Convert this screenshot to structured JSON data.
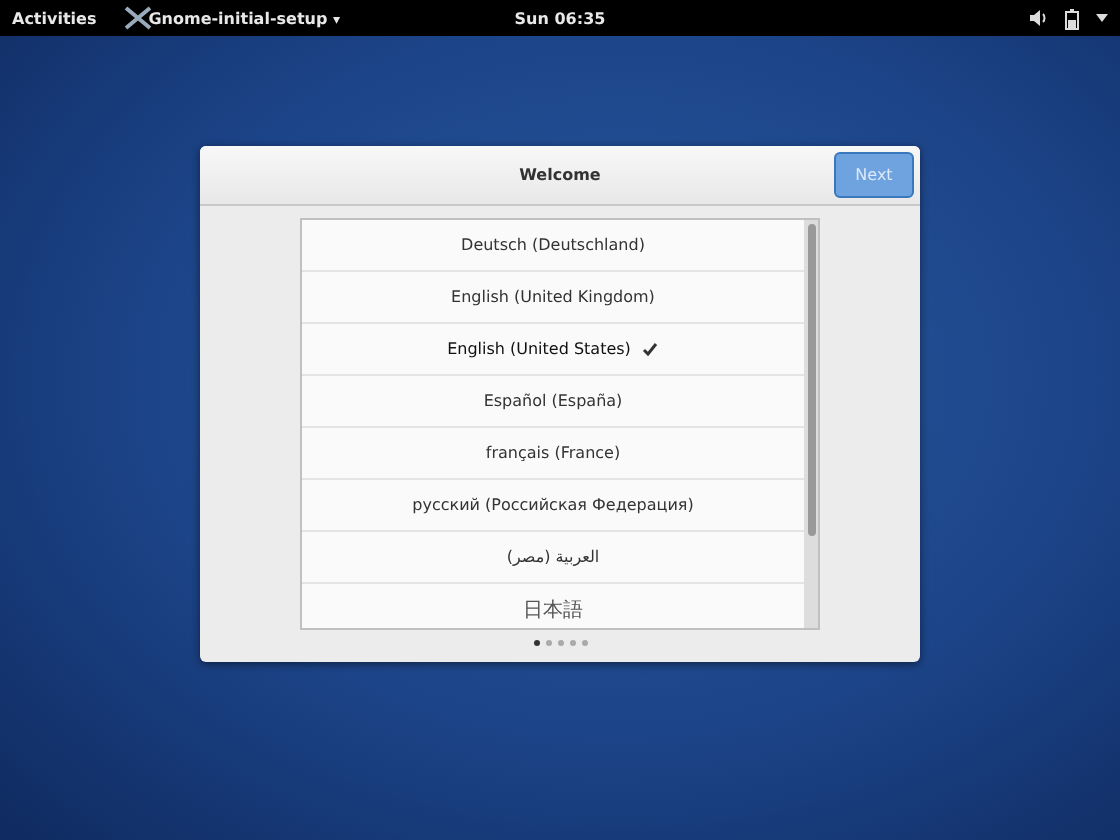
{
  "top_bar": {
    "activities": "Activities",
    "app_menu": "Gnome-initial-setup",
    "app_menu_caret": "▾",
    "clock": "Sun 06:35"
  },
  "dialog": {
    "title": "Welcome",
    "next_button": {
      "label": "Next",
      "disabled": true
    },
    "languages": [
      {
        "label": "Deutsch (Deutschland)",
        "selected": false
      },
      {
        "label": "English (United Kingdom)",
        "selected": false
      },
      {
        "label": "English (United States)",
        "selected": true
      },
      {
        "label": "Español (España)",
        "selected": false
      },
      {
        "label": "français (France)",
        "selected": false
      },
      {
        "label": "русский (Российская Федерация)",
        "selected": false
      },
      {
        "label": "العربية (مصر)",
        "selected": false
      },
      {
        "label": "日本語",
        "selected": false
      }
    ],
    "pages": [
      {
        "selected": true
      },
      {
        "selected": false
      },
      {
        "selected": false
      },
      {
        "selected": false
      },
      {
        "selected": false
      }
    ]
  }
}
